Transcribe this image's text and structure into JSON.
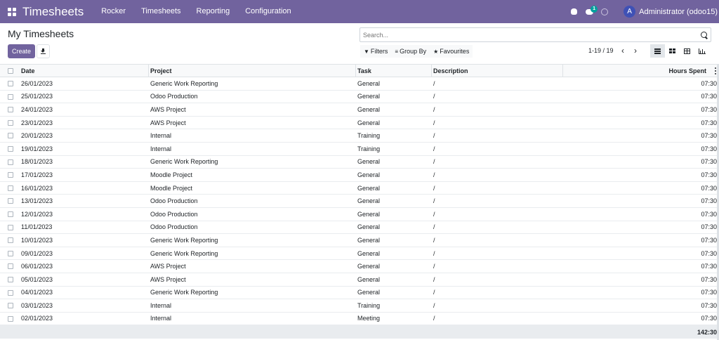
{
  "navbar": {
    "brand": "Timesheets",
    "menu": [
      "Rocker",
      "Timesheets",
      "Reporting",
      "Configuration"
    ],
    "chat_badge": "1",
    "user_initial": "A",
    "user_name": "Administrator (odoo15)",
    "bg_color": "#71639e"
  },
  "control": {
    "breadcrumb": "My Timesheets",
    "create_label": "Create",
    "search_placeholder": "Search...",
    "filters_label": "Filters",
    "groupby_label": "Group By",
    "favourites_label": "Favourites",
    "pager": "1-19 / 19"
  },
  "table": {
    "headers": {
      "date": "Date",
      "project": "Project",
      "task": "Task",
      "description": "Description",
      "hours": "Hours Spent"
    },
    "rows": [
      {
        "date": "26/01/2023",
        "project": "Generic Work Reporting",
        "task": "General",
        "description": "/",
        "hours": "07:30"
      },
      {
        "date": "25/01/2023",
        "project": "Odoo Production",
        "task": "General",
        "description": "/",
        "hours": "07:30"
      },
      {
        "date": "24/01/2023",
        "project": "AWS Project",
        "task": "General",
        "description": "/",
        "hours": "07:30"
      },
      {
        "date": "23/01/2023",
        "project": "AWS Project",
        "task": "General",
        "description": "/",
        "hours": "07:30"
      },
      {
        "date": "20/01/2023",
        "project": "Internal",
        "task": "Training",
        "description": "/",
        "hours": "07:30"
      },
      {
        "date": "19/01/2023",
        "project": "Internal",
        "task": "Training",
        "description": "/",
        "hours": "07:30"
      },
      {
        "date": "18/01/2023",
        "project": "Generic Work Reporting",
        "task": "General",
        "description": "/",
        "hours": "07:30"
      },
      {
        "date": "17/01/2023",
        "project": "Moodle Project",
        "task": "General",
        "description": "/",
        "hours": "07:30"
      },
      {
        "date": "16/01/2023",
        "project": "Moodle Project",
        "task": "General",
        "description": "/",
        "hours": "07:30"
      },
      {
        "date": "13/01/2023",
        "project": "Odoo Production",
        "task": "General",
        "description": "/",
        "hours": "07:30"
      },
      {
        "date": "12/01/2023",
        "project": "Odoo Production",
        "task": "General",
        "description": "/",
        "hours": "07:30"
      },
      {
        "date": "11/01/2023",
        "project": "Odoo Production",
        "task": "General",
        "description": "/",
        "hours": "07:30"
      },
      {
        "date": "10/01/2023",
        "project": "Generic Work Reporting",
        "task": "General",
        "description": "/",
        "hours": "07:30"
      },
      {
        "date": "09/01/2023",
        "project": "Generic Work Reporting",
        "task": "General",
        "description": "/",
        "hours": "07:30"
      },
      {
        "date": "06/01/2023",
        "project": "AWS Project",
        "task": "General",
        "description": "/",
        "hours": "07:30"
      },
      {
        "date": "05/01/2023",
        "project": "AWS Project",
        "task": "General",
        "description": "/",
        "hours": "07:30"
      },
      {
        "date": "04/01/2023",
        "project": "Generic Work Reporting",
        "task": "General",
        "description": "/",
        "hours": "07:30"
      },
      {
        "date": "03/01/2023",
        "project": "Internal",
        "task": "Training",
        "description": "/",
        "hours": "07:30"
      },
      {
        "date": "02/01/2023",
        "project": "Internal",
        "task": "Meeting",
        "description": "/",
        "hours": "07:30"
      }
    ],
    "total_hours": "142:30"
  }
}
